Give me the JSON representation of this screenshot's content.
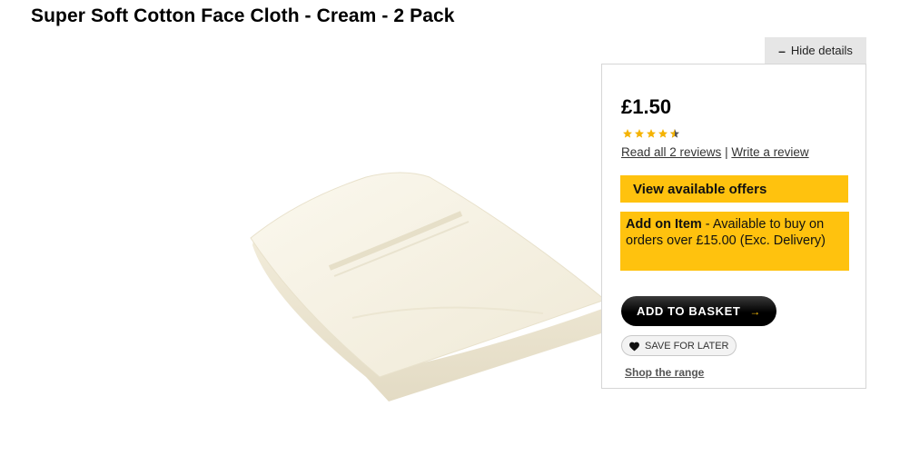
{
  "product": {
    "title": "Super Soft Cotton Face Cloth - Cream - 2 Pack",
    "price": "£1.50",
    "rating": 4.5,
    "rating_max": 5,
    "read_reviews": "Read all 2 reviews",
    "separator": "|",
    "write_review": "Write a review"
  },
  "details_toggle": {
    "label": "Hide details",
    "icon": "minus-icon"
  },
  "offers": {
    "label": "View available offers"
  },
  "addon": {
    "title": "Add on Item",
    "text": " - Available to buy on orders over £15.00 (Exc. Delivery)"
  },
  "actions": {
    "add_to_basket": "ADD TO BASKET",
    "add_to_basket_arrow": "→",
    "save_for_later": "SAVE FOR LATER",
    "shop_range": "Shop the range"
  },
  "colors": {
    "accent_yellow": "#ffc20e",
    "button_black": "#000000",
    "star": "#f5b301"
  }
}
